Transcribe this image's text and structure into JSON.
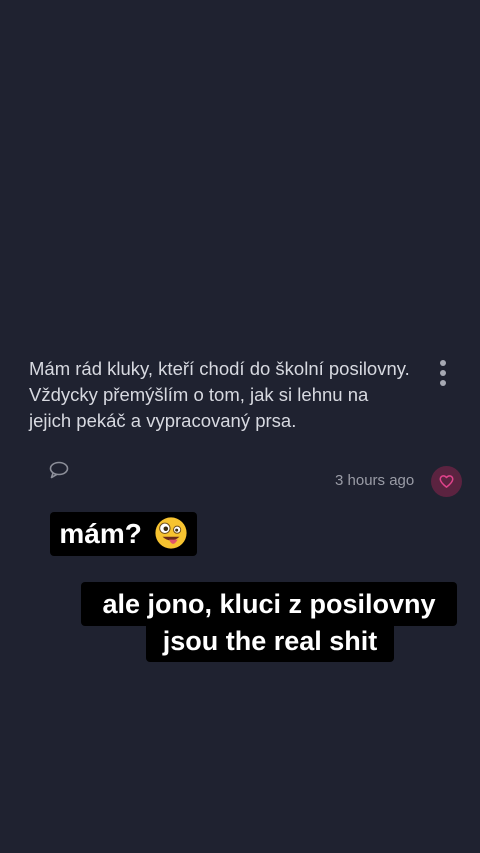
{
  "post": {
    "text": "Mám rád kluky, kteří chodí do školní posilovny. Vždycky přemýšlím o tom, jak si lehnu na jejich pekáč a vypracovaný prsa.",
    "timestamp": "3 hours ago"
  },
  "stickers": {
    "first": "mám?",
    "first_emoji": "zany-face-emoji",
    "second_line1": "ale jono, kluci z posilovny",
    "second_line2": "jsou the real shit"
  },
  "icons": {
    "menu": "more-vertical-icon",
    "comment": "comment-icon",
    "heart": "heart-icon"
  },
  "colors": {
    "background": "#1f2230",
    "heart_bg": "#5b2340",
    "heart_fg": "#e0438b"
  }
}
